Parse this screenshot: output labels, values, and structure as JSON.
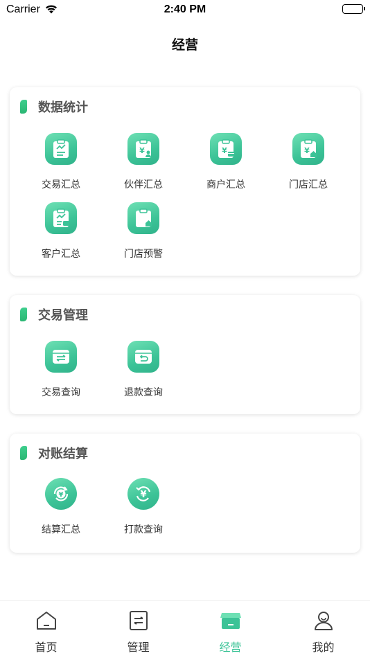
{
  "status_bar": {
    "carrier": "Carrier",
    "time": "2:40 PM"
  },
  "nav": {
    "title": "经营"
  },
  "sections": [
    {
      "title": "数据统计",
      "items": [
        {
          "label": "交易汇总",
          "icon": "chart-clipboard-icon"
        },
        {
          "label": "伙伴汇总",
          "icon": "yen-clipboard-person-icon"
        },
        {
          "label": "商户汇总",
          "icon": "yen-clipboard-card-icon"
        },
        {
          "label": "门店汇总",
          "icon": "yen-clipboard-store-icon"
        },
        {
          "label": "客户汇总",
          "icon": "chart-clipboard-card-icon"
        },
        {
          "label": "门店预警",
          "icon": "clipboard-store-alert-icon"
        }
      ]
    },
    {
      "title": "交易管理",
      "items": [
        {
          "label": "交易查询",
          "icon": "transfer-box-icon"
        },
        {
          "label": "退款查询",
          "icon": "refund-box-icon"
        }
      ]
    },
    {
      "title": "对账结算",
      "items": [
        {
          "label": "结算汇总",
          "icon": "yen-cycle-icon"
        },
        {
          "label": "打款查询",
          "icon": "yen-payment-icon"
        }
      ]
    }
  ],
  "tabs": [
    {
      "label": "首页",
      "icon": "home-icon"
    },
    {
      "label": "管理",
      "icon": "manage-icon"
    },
    {
      "label": "经营",
      "icon": "business-icon",
      "active": true
    },
    {
      "label": "我的",
      "icon": "user-icon"
    }
  ],
  "colors": {
    "accent": "#3cc397",
    "accent_light": "#6ee0b4",
    "text": "#333333"
  }
}
